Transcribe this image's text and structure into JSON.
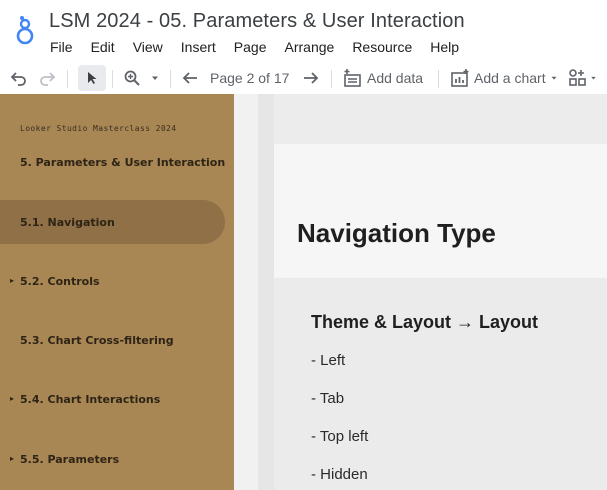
{
  "app": {
    "title": "LSM 2024 - 05. Parameters & User Interaction"
  },
  "menu": [
    "File",
    "Edit",
    "View",
    "Insert",
    "Page",
    "Arrange",
    "Resource",
    "Help"
  ],
  "toolbar": {
    "icons": [
      "undo-icon",
      "redo-icon",
      "select-pointer-icon",
      "zoom-icon",
      "arrow-left-icon",
      "arrow-right-icon",
      "add-data-icon",
      "add-chart-icon",
      "add-control-icon"
    ],
    "page_indicator": "Page 2 of 17",
    "add_data_label": "Add data",
    "add_chart_label": "Add a chart"
  },
  "sidebar": {
    "heading": "Looker Studio Masterclass 2024",
    "items": [
      {
        "label": "5. Parameters & User Interaction",
        "active": false
      },
      {
        "label": "5.1. Navigation",
        "active": true
      },
      {
        "label": "5.2. Controls",
        "active": false
      },
      {
        "label": "5.3. Chart Cross-filtering",
        "active": false
      },
      {
        "label": "5.4. Chart Interactions",
        "active": false
      },
      {
        "label": "5.5. Parameters",
        "active": false
      }
    ]
  },
  "page": {
    "title": "Navigation Type",
    "section_heading": "Theme & Layout → Layout",
    "options": [
      "- Left",
      "- Tab",
      "- Top left",
      "- Hidden"
    ]
  },
  "colors": {
    "sidebar_bg": "#a98755",
    "sidebar_active": "#8f7047",
    "logo_blue": "#4285f4"
  }
}
